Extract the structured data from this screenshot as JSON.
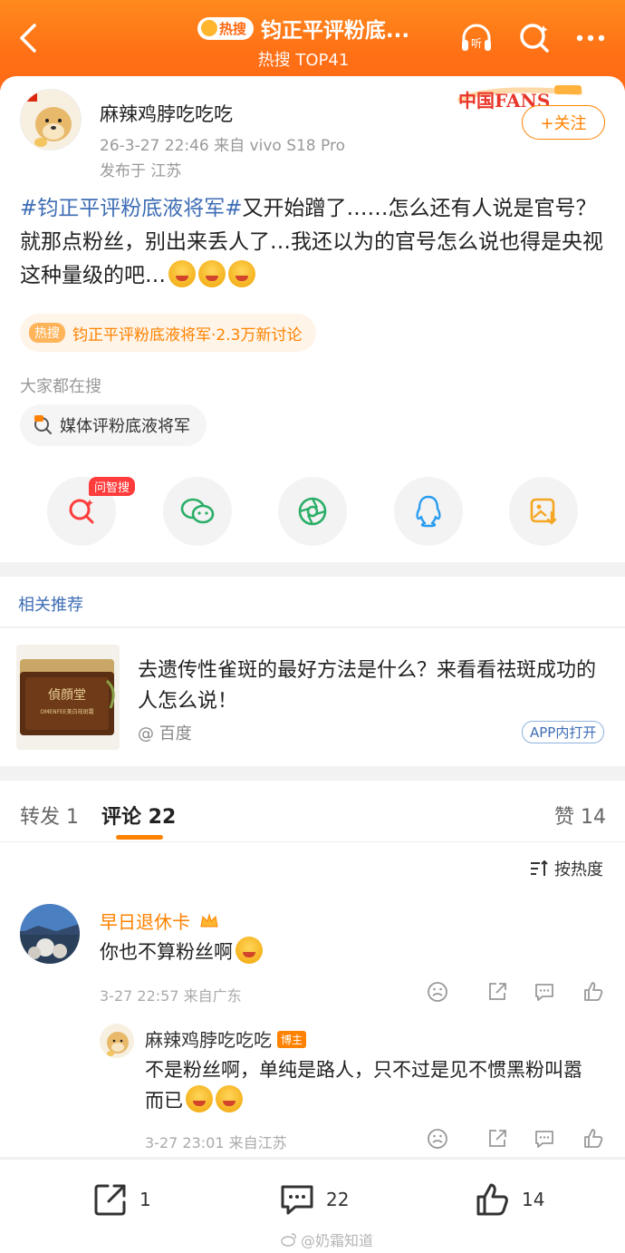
{
  "header": {
    "hot_label": "热搜",
    "title": "钧正平评粉底...",
    "subtitle": "热搜 TOP41",
    "listen_label": "听"
  },
  "post": {
    "username": "麻辣鸡脖吃吃吃",
    "meta": "26-3-27 22:46   来自 vivo S18 Pro",
    "location": "发布于 江苏",
    "follow_label": "+关注",
    "fans_badge": "中国FANS",
    "topic": "#钧正平评粉底液将军#",
    "body": "又开始蹭了……怎么还有人说是官号？就那点粉丝，别出来丢人了…我还以为的官号怎么说也得是央视这种量级的吧…",
    "hot_topic_tag": "热搜",
    "hot_topic": "钧正平评粉底液将军·2.3万新讨论",
    "search_label": "大家都在搜",
    "search_chip": "媒体评粉底液将军",
    "ai_tag": "问智搜"
  },
  "recommend": {
    "header": "相关推荐",
    "title": "去遗传性雀斑的最好方法是什么？来看看祛斑成功的人怎么说！",
    "source": "@ 百度",
    "app_label": "APP内打开",
    "product_text": "OMENFEE美白祛斑霜",
    "product_brand": "偵顔堂"
  },
  "tabs": {
    "repost": "转发 1",
    "comments": "评论 22",
    "likes": "赞 14"
  },
  "comments": {
    "sort_label": "按热度",
    "items": [
      {
        "name": "早日退休卡",
        "text": "你也不算粉丝啊",
        "meta": "3-27 22:57  来自广东"
      },
      {
        "name": "麻辣鸡脖吃吃吃",
        "owner_badge": "博主",
        "text": "不是粉丝啊，单纯是路人，只不过是见不惯黑粉叫嚣而已",
        "meta": "3-27 23:01  来自江苏"
      }
    ]
  },
  "bottom_bar": {
    "repost_count": "1",
    "comment_count": "22",
    "like_count": "14"
  },
  "watermark": "@奶霜知道",
  "colors": {
    "header": "#ff7016",
    "accent": "#ff8200",
    "link": "#3e6db5"
  }
}
